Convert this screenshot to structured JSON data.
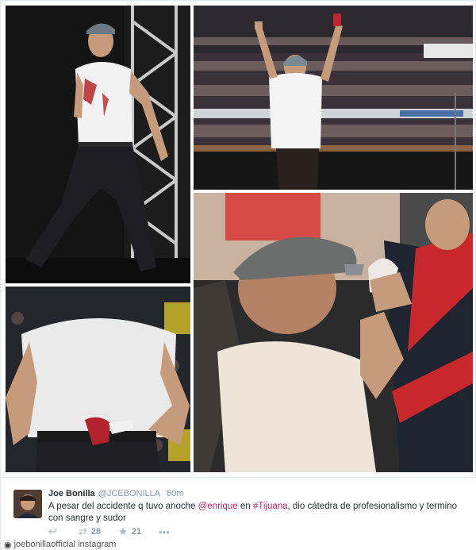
{
  "tweet": {
    "author_name": "Joe Bonilla",
    "author_handle": "@JCEBONILLA",
    "time": "60m",
    "text_before": "A pesar del accidente q tuvo anoche ",
    "mention_1": "@enrique",
    "text_mid_1": " en ",
    "mention_2": "#Tijuana",
    "text_after": ", dio cátedra de profesionalismo y termino con sangre y sudor",
    "mention_color": "#c0275c"
  },
  "actions": [
    {
      "icon": "reply-icon",
      "glyph": "↩",
      "count": ""
    },
    {
      "icon": "retweet-icon",
      "glyph": "⇄",
      "count": "28"
    },
    {
      "icon": "favorite-icon",
      "glyph": "★",
      "count": "21"
    },
    {
      "icon": "more-icon",
      "glyph": "•••",
      "count": ""
    }
  ],
  "watermark": {
    "icon": "camera-icon",
    "text": "joebonillaofficial instagram"
  },
  "photos": [
    {
      "name": "photo-singer-on-stage"
    },
    {
      "name": "photo-singer-arms-raised"
    },
    {
      "name": "photo-bloody-hand-back"
    },
    {
      "name": "photo-singer-with-fans"
    }
  ]
}
